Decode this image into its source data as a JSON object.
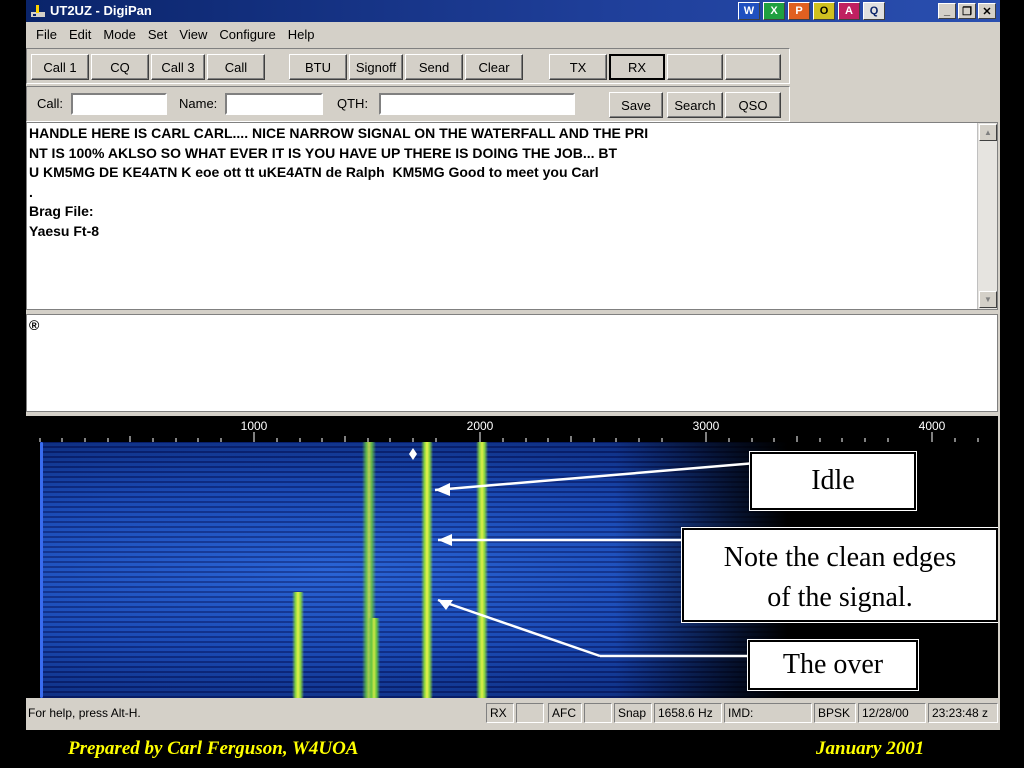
{
  "window": {
    "title": "UT2UZ - DigiPan",
    "controls": [
      "_",
      "❐",
      "✕"
    ]
  },
  "taskbar_icons": [
    "W",
    "X",
    "P",
    "O",
    "A",
    "Q"
  ],
  "menu": [
    "File",
    "Edit",
    "Mode",
    "Set",
    "View",
    "Configure",
    "Help"
  ],
  "toolbar1": [
    "Call 1",
    "CQ",
    "Call 3",
    "Call",
    "BTU",
    "Signoff",
    "Send",
    "Clear",
    "TX",
    "RX",
    "",
    ""
  ],
  "toolbar2": {
    "call_label": "Call:",
    "call_value": "",
    "name_label": "Name:",
    "name_value": "",
    "qth_label": "QTH:",
    "qth_value": "",
    "buttons": [
      "Save",
      "Search",
      "QSO"
    ]
  },
  "rx_text": [
    "HANDLE HERE IS CARL CARL.... NICE NARROW SIGNAL ON THE WATERFALL AND THE PRI",
    "NT IS 100% AKLSO SO WHAT EVER IT IS YOU HAVE UP THERE IS DOING THE JOB... BT",
    "U KM5MG DE KE4ATN K eoe ott tt uKE4ATN de Ralph  KM5MG Good to meet you Carl",
    ".",
    "Brag File:",
    "Yaesu Ft-8"
  ],
  "tx_text": "®",
  "waterfall": {
    "scale_labels": [
      "1000",
      "2000",
      "3000",
      "4000"
    ],
    "annotations": {
      "idle": "Idle",
      "clean_edges_1": "Note the clean edges",
      "clean_edges_2": "of the signal.",
      "over": "The over"
    }
  },
  "status": {
    "help": "For help, press Alt-H.",
    "rx": "RX",
    "afc": "AFC",
    "snap": "Snap",
    "freq": "1658.6 Hz",
    "imd": "IMD:",
    "mode": "BPSK",
    "date": "12/28/00",
    "time": "23:23:48 z"
  },
  "footer": {
    "left": "Prepared by Carl Ferguson, W4UOA",
    "right": "January 2001"
  },
  "colors": {
    "titlebar": "#0a246a",
    "face": "#d4d0c8",
    "footer_text": "#ffff00",
    "signal": "#e8f24a"
  }
}
